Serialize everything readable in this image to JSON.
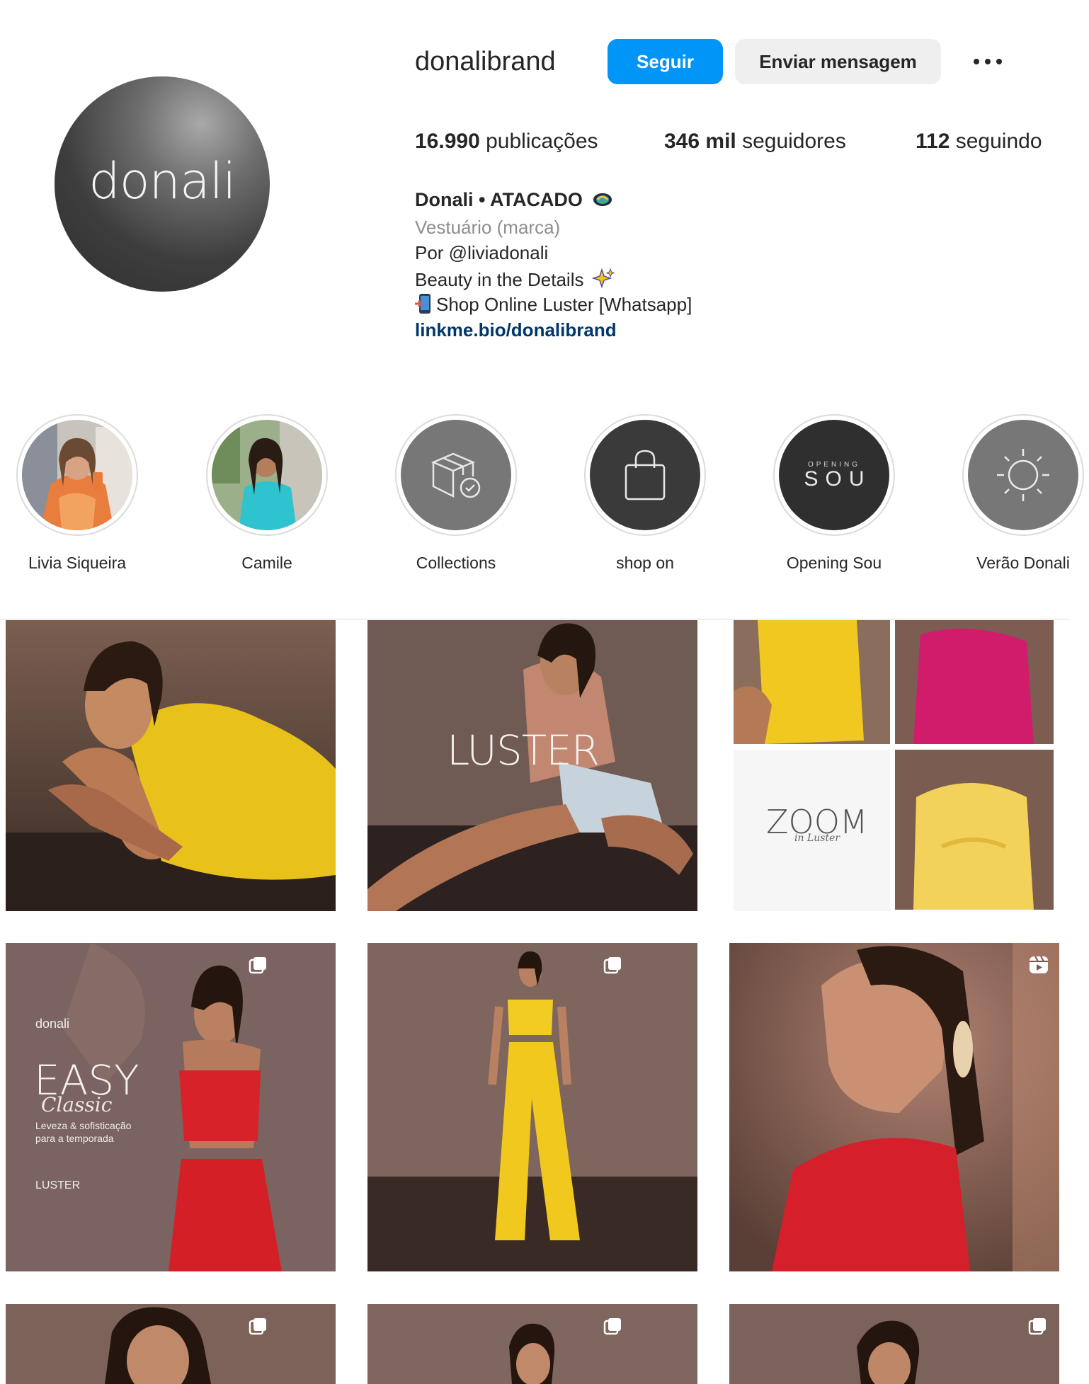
{
  "profile": {
    "avatar_text": "donali",
    "username": "donalibrand",
    "follow_label": "Seguir",
    "message_label": "Enviar mensagem",
    "stats": [
      {
        "value": "16.990",
        "label": "publicações"
      },
      {
        "value": "346 mil",
        "label": "seguidores"
      },
      {
        "value": "112",
        "label": "seguindo"
      }
    ],
    "bio": {
      "name": "Donali • ATACADO",
      "category": "Vestuário (marca)",
      "line1": "Por @liviadonali",
      "line2": "Beauty in the Details",
      "line3": "Shop Online Luster [Whatsapp]",
      "link": "linkme.bio/donalibrand"
    }
  },
  "highlights": [
    {
      "label": "Livia Siqueira",
      "icon": "photo-woman-orange"
    },
    {
      "label": "Camile",
      "icon": "photo-woman-turquoise"
    },
    {
      "label": "Collections",
      "icon": "box-check-icon"
    },
    {
      "label": "shop on",
      "icon": "shopping-bag-icon"
    },
    {
      "label": "Opening Sou",
      "icon": "opening-sou-text",
      "small": "OPENING",
      "big": "SOU"
    },
    {
      "label": "Verão Donali",
      "icon": "sun-icon"
    }
  ],
  "posts": [
    {
      "caption": ""
    },
    {
      "caption": "LUSTER"
    },
    {
      "caption": "ZOOM",
      "sub": "in Luster"
    },
    {
      "caption": "EASY",
      "sub": "Classic",
      "brand": "donali",
      "line1": "Leveza & sofisticação",
      "line2": "para a temporada",
      "footer": "LUSTER"
    },
    {
      "caption": ""
    },
    {
      "caption": ""
    }
  ]
}
